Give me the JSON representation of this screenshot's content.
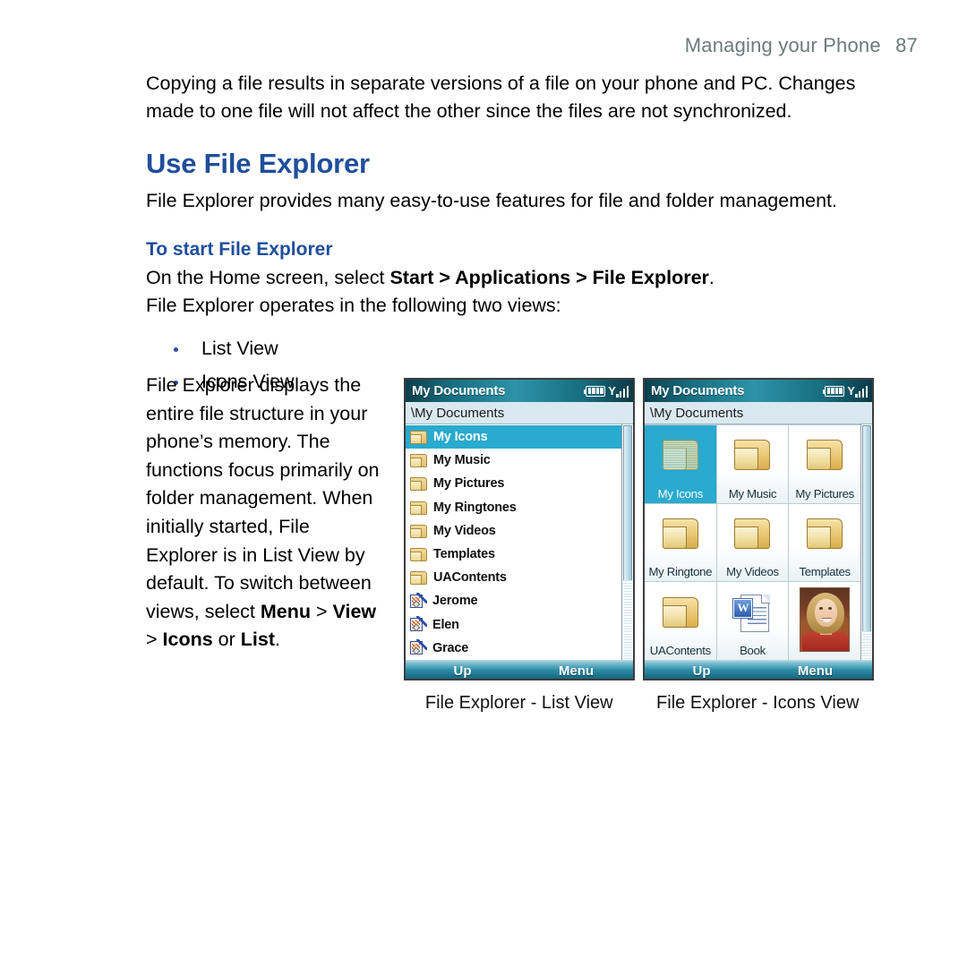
{
  "header": {
    "title": "Managing your Phone",
    "page_number": "87"
  },
  "intro": {
    "paragraph": "Copying a file results in separate versions of a file on your phone and PC. Changes made to one file will not affect the other since the files are not synchronized."
  },
  "section": {
    "title": "Use File Explorer",
    "description": "File Explorer provides many easy-to-use features for file and folder management.",
    "subsection_title": "To start File Explorer",
    "step_prefix": "On the Home screen, select ",
    "step_bold": "Start > Applications > File Explorer",
    "step_suffix": ".",
    "views_intro": "File Explorer operates in the following two views:",
    "bullets": [
      "List View",
      "Icons View"
    ]
  },
  "left_column": {
    "text_1": "File Explorer displays the entire file structure in your phone’s memory. The functions focus primarily on folder management. When initially started, File Explorer is in List View by default. To switch between views, select ",
    "bold_1": "Menu",
    "sep_1": " > ",
    "bold_2": "View",
    "sep_2": " > ",
    "bold_3": "Icons",
    "text_2": " or ",
    "bold_4": "List",
    "text_3": "."
  },
  "colors": {
    "heading_blue": "#1f4e9c",
    "header_gray": "#6b7b7a",
    "selection_cyan": "#29aace",
    "titlebar_teal": "#176d80",
    "pathbar_blue": "#d9e9ef",
    "folder_gold": "#e9c672"
  },
  "phone_list_view": {
    "title": "My Documents",
    "path": "\\My Documents",
    "status_icons": [
      "battery-icon",
      "signal-icon"
    ],
    "items": [
      {
        "label": "My Icons",
        "icon": "folder-icon",
        "selected": true
      },
      {
        "label": "My Music",
        "icon": "folder-icon",
        "selected": false
      },
      {
        "label": "My Pictures",
        "icon": "folder-icon",
        "selected": false
      },
      {
        "label": "My Ringtones",
        "icon": "folder-icon",
        "selected": false
      },
      {
        "label": "My Videos",
        "icon": "folder-icon",
        "selected": false
      },
      {
        "label": "Templates",
        "icon": "folder-icon",
        "selected": false
      },
      {
        "label": "UAContents",
        "icon": "folder-icon",
        "selected": false
      },
      {
        "label": "Jerome",
        "icon": "note-icon",
        "selected": false
      },
      {
        "label": "Elen",
        "icon": "note-icon",
        "selected": false
      },
      {
        "label": "Grace",
        "icon": "note-icon",
        "selected": false
      }
    ],
    "softkey_left": "Up",
    "softkey_right": "Menu"
  },
  "phone_icons_view": {
    "title": "My Documents",
    "path": "\\My Documents",
    "status_icons": [
      "battery-icon",
      "signal-icon"
    ],
    "cells": [
      {
        "label": "My Icons",
        "icon": "folder-icon",
        "selected": true
      },
      {
        "label": "My Music",
        "icon": "folder-icon",
        "selected": false
      },
      {
        "label": "My Pictures",
        "icon": "folder-icon",
        "selected": false
      },
      {
        "label": "My Ringtone",
        "icon": "folder-icon",
        "selected": false
      },
      {
        "label": "My Videos",
        "icon": "folder-icon",
        "selected": false
      },
      {
        "label": "Templates",
        "icon": "folder-icon",
        "selected": false
      },
      {
        "label": "UAContents",
        "icon": "folder-icon",
        "selected": false
      },
      {
        "label": "Book",
        "icon": "word-document-icon",
        "selected": false
      },
      {
        "label": "",
        "icon": "photo-thumbnail-icon",
        "selected": false
      }
    ],
    "softkey_left": "Up",
    "softkey_right": "Menu"
  },
  "captions": {
    "list_view": "File Explorer - List View",
    "icons_view": "File Explorer - Icons View"
  }
}
